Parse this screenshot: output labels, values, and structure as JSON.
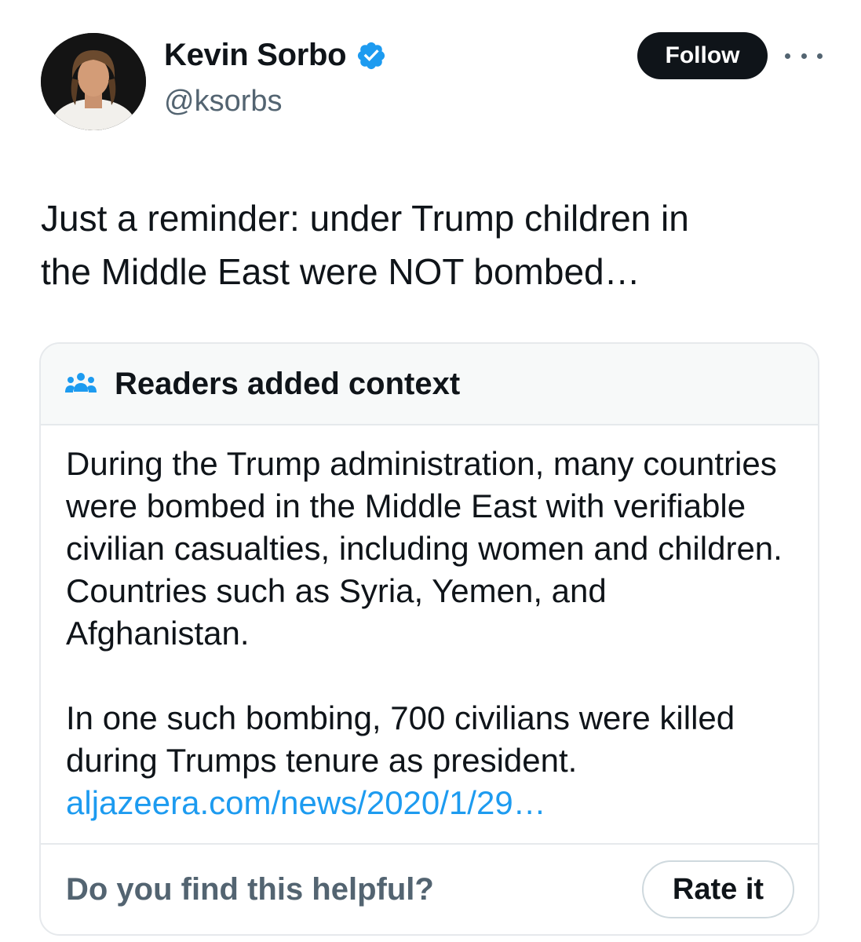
{
  "author": {
    "display_name": "Kevin Sorbo",
    "handle": "@ksorbs",
    "verified": true,
    "avatar": "profile-photo"
  },
  "actions": {
    "follow_label": "Follow",
    "more_icon": "more-horizontal-icon"
  },
  "tweet": {
    "text": "Just a reminder: under Trump children in\nthe Middle East were NOT bombed…"
  },
  "community_note": {
    "header_icon": "people-icon",
    "title": "Readers added context",
    "paragraph1": "During the Trump administration, many countries were bombed in the Middle East with verifiable civilian casualties, including women and children. Countries such as Syria, Yemen, and Afghanistan.",
    "paragraph2": "In one such bombing, 700 civilians were killed during Trumps tenure as president.",
    "link_text": "aljazeera.com/news/2020/1/29…",
    "footer_question": "Do you find this helpful?",
    "rate_label": "Rate it"
  },
  "colors": {
    "text_primary": "#0f1419",
    "text_secondary": "#536471",
    "link": "#1d9bf0",
    "verified_badge": "#1d9bf0",
    "follow_button_bg": "#0f1419",
    "note_header_bg": "#f7f9f9",
    "border": "#e6e9ec"
  }
}
